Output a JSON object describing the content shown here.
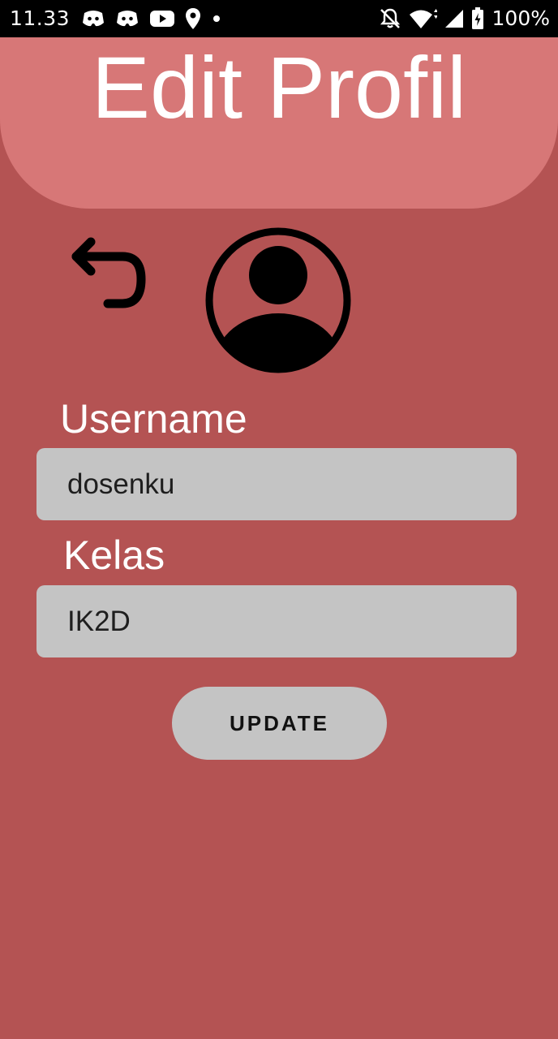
{
  "status_bar": {
    "time": "11.33",
    "battery": "100%",
    "left_icons": [
      "discord-icon",
      "discord-icon",
      "youtube-icon",
      "location-icon",
      "dot-icon"
    ],
    "right_icons": [
      "bell-off-icon",
      "wifi-icon",
      "signal-icon",
      "battery-charging-icon"
    ]
  },
  "header": {
    "title": "Edit Profil"
  },
  "back_icon": "undo-arrow-icon",
  "avatar_icon": "user-avatar-icon",
  "form": {
    "username_label": "Username",
    "username_value": "dosenku",
    "kelas_label": "Kelas",
    "kelas_value": "IK2D",
    "update_label": "UPDATE"
  },
  "colors": {
    "background": "#b45353",
    "header": "#d77777",
    "input": "#c4c4c4",
    "button": "#c4c4c4",
    "text_light": "#ffffff"
  }
}
